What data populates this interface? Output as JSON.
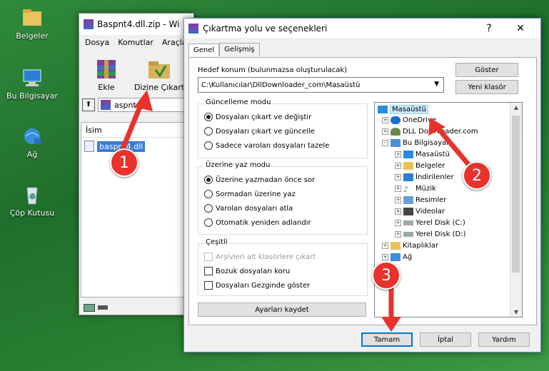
{
  "desktop": {
    "icons": [
      {
        "label": "Belgeler"
      },
      {
        "label": "Bu Bilgisayar"
      },
      {
        "label": "Ağ"
      },
      {
        "label": "Çöp Kutusu"
      }
    ]
  },
  "winrar": {
    "title": "Baspnt4.dll.zip - Wi",
    "menu": [
      "Dosya",
      "Komutlar",
      "Araçla"
    ],
    "tools": {
      "add": "Ekle",
      "extract": "Dizine Çıkart"
    },
    "path": "aspnt4.dl",
    "column_name": "İsim",
    "file": "baspnt4.dll"
  },
  "dialog": {
    "title": "Çıkartma yolu ve seçenekleri",
    "help": "?",
    "close": "✕",
    "tabs": [
      "Genel",
      "Gelişmiş"
    ],
    "dest_label": "Hedef konum (bulunmazsa oluşturulacak)",
    "dest_value": "C:\\Kullanıcılar\\DllDownloader_com\\Masaüstü",
    "show_btn": "Göster",
    "new_folder_btn": "Yeni klasör",
    "update_group": {
      "title": "Güncelleme modu",
      "options": [
        "Dosyaları çıkart ve değiştir",
        "Dosyaları çıkart ve güncelle",
        "Sadece varolan dosyaları tazele"
      ]
    },
    "overwrite_group": {
      "title": "Üzerine yaz modu",
      "options": [
        "Üzerine yazmadan önce sor",
        "Sormadan üzerine yaz",
        "Varolan dosyaları atla",
        "Otomatik yeniden adlandır"
      ]
    },
    "misc_group": {
      "title": "Çeşitli",
      "options": [
        "Arşivleri alt klasörlere çıkart",
        "Bozuk dosyaları koru",
        "Dosyaları Gezginde göster"
      ]
    },
    "save_btn": "Ayarları kaydet",
    "tree": [
      "Masaüstü",
      "OneDrive",
      "DLL Downloader.com",
      "Bu Bilgisayar",
      "Masaüstü",
      "Belgeler",
      "İndirilenler",
      "Müzik",
      "Resimler",
      "Videolar",
      "Yerel Disk (C:)",
      "Yerel Disk (D:)",
      "Kitaplıklar",
      "Ağ"
    ],
    "ok_btn": "Tamam",
    "cancel_btn": "İptal",
    "help_btn": "Yardım"
  },
  "annotations": [
    "1",
    "2",
    "3"
  ],
  "colors": {
    "annotation": "#e8322b",
    "selection": "#cce8ff"
  }
}
